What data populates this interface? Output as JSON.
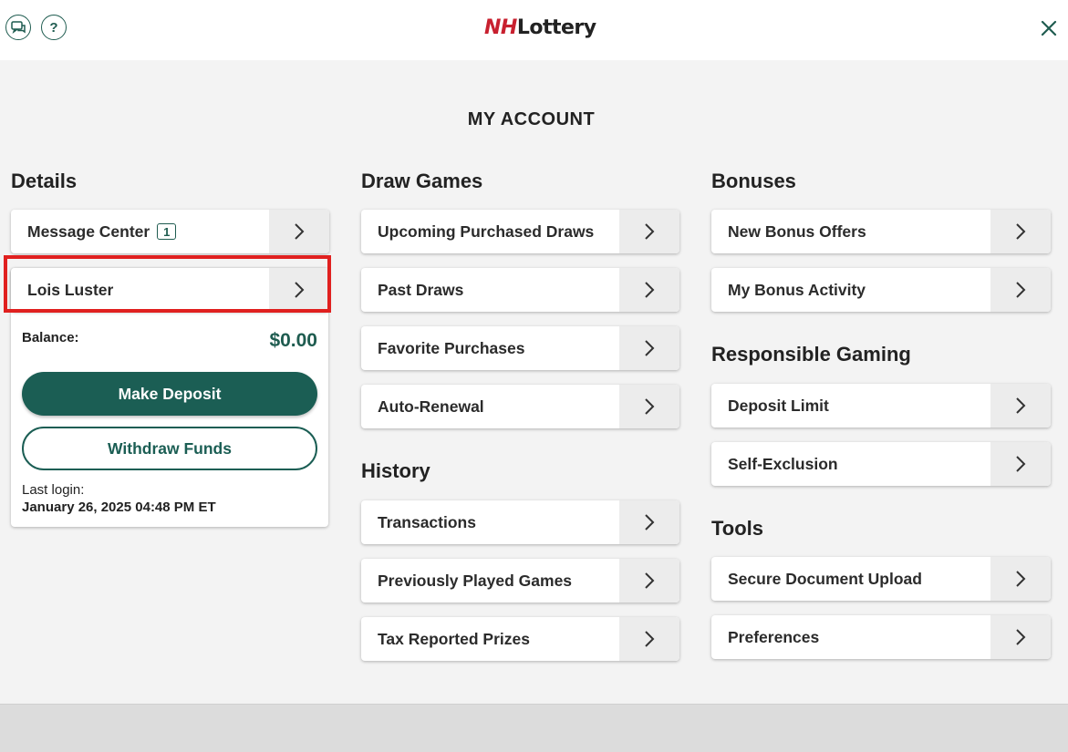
{
  "header": {
    "logo_nh": "NH",
    "logo_rest": "Lottery",
    "help_glyph": "?",
    "icons": [
      "chat-icon",
      "help-icon",
      "close-icon"
    ]
  },
  "page_title": "MY ACCOUNT",
  "details": {
    "title": "Details",
    "message_center": {
      "label": "Message Center",
      "badge": "1"
    },
    "account_name": "Lois Luster",
    "balance_label": "Balance:",
    "balance_value": "$0.00",
    "deposit_button": "Make Deposit",
    "withdraw_button": "Withdraw Funds",
    "last_login_label": "Last login:",
    "last_login_value": "January 26, 2025 04:48 PM ET"
  },
  "draw_games": {
    "title": "Draw Games",
    "items": [
      "Upcoming Purchased Draws",
      "Past Draws",
      "Favorite Purchases",
      "Auto-Renewal"
    ]
  },
  "history": {
    "title": "History",
    "items": [
      "Transactions",
      "Previously Played Games",
      "Tax Reported Prizes"
    ]
  },
  "bonuses": {
    "title": "Bonuses",
    "items": [
      "New Bonus Offers",
      "My Bonus Activity"
    ]
  },
  "responsible_gaming": {
    "title": "Responsible Gaming",
    "items": [
      "Deposit Limit",
      "Self-Exclusion"
    ]
  },
  "tools": {
    "title": "Tools",
    "items": [
      "Secure Document Upload",
      "Preferences"
    ]
  },
  "colors": {
    "brand_green": "#1b5e54",
    "logo_red": "#c8202f",
    "highlight_red": "#e0201f"
  }
}
